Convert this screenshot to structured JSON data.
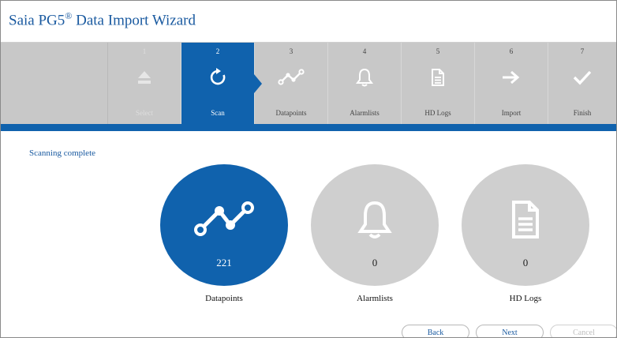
{
  "window": {
    "title": "Saia PG5",
    "title_sup": "®",
    "title_suffix": " Data Import Wizard"
  },
  "steps": [
    {
      "number": "1",
      "label": "Select",
      "icon": "upload-icon",
      "state": "disabled"
    },
    {
      "number": "2",
      "label": "Scan",
      "icon": "refresh-icon",
      "state": "active"
    },
    {
      "number": "3",
      "label": "Datapoints",
      "icon": "chart-line-icon",
      "state": "pending"
    },
    {
      "number": "4",
      "label": "Alarmlists",
      "icon": "bell-icon",
      "state": "pending"
    },
    {
      "number": "5",
      "label": "HD Logs",
      "icon": "document-icon",
      "state": "pending"
    },
    {
      "number": "6",
      "label": "Import",
      "icon": "arrow-right-icon",
      "state": "pending"
    },
    {
      "number": "7",
      "label": "Finish",
      "icon": "checkmark-icon",
      "state": "pending"
    }
  ],
  "status_text": "Scanning complete",
  "results": [
    {
      "label": "Datapoints",
      "count": "221",
      "icon": "chart-line-icon",
      "highlight": true
    },
    {
      "label": "Alarmlists",
      "count": "0",
      "icon": "bell-icon",
      "highlight": false
    },
    {
      "label": "HD Logs",
      "count": "0",
      "icon": "document-icon",
      "highlight": false
    }
  ],
  "buttons": {
    "back": "Back",
    "next": "Next",
    "cancel": "Cancel"
  },
  "colors": {
    "accent": "#1062ad",
    "step_bar": "#c8c8c8",
    "inactive_circle": "#cfcfcf"
  }
}
